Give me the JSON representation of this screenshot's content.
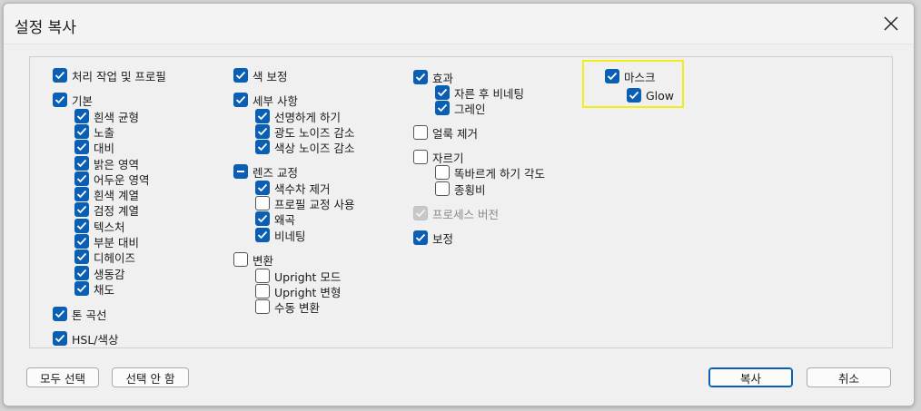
{
  "dialog": {
    "title": "설정 복사",
    "close_icon": "close-icon"
  },
  "col1": {
    "processing": "처리 작업 및 프로필",
    "basic": "기본",
    "basic_items": [
      "흰색 균형",
      "노출",
      "대비",
      "밝은 영역",
      "어두운 영역",
      "흰색 계열",
      "검정 계열",
      "텍스처",
      "부분 대비",
      "디헤이즈",
      "생동감",
      "채도"
    ],
    "tone_curve": "톤 곡선",
    "hsl": "HSL/색상"
  },
  "col2": {
    "color_grading": "색 보정",
    "detail": "세부 사항",
    "detail_items": [
      "선명하게 하기",
      "광도 노이즈 감소",
      "색상 노이즈 감소"
    ],
    "lens": "렌즈 교정",
    "lens_items": [
      "색수차 제거",
      "프로필 교정 사용",
      "왜곡",
      "비네팅"
    ],
    "transform": "변환",
    "transform_items": [
      "Upright 모드",
      "Upright 변형",
      "수동 변환"
    ]
  },
  "col3": {
    "effects": "효과",
    "effects_items": [
      "자른 후 비네팅",
      "그레인"
    ],
    "spot_removal": "얼룩 제거",
    "crop": "자르기",
    "crop_items": [
      "똑바르게 하기 각도",
      "종횡비"
    ],
    "process_version": "프로세스 버전",
    "calibration": "보정"
  },
  "col4": {
    "masks": "마스크",
    "masks_items": [
      "Glow"
    ]
  },
  "buttons": {
    "select_all": "모두 선택",
    "select_none": "선택 안 함",
    "copy": "복사",
    "cancel": "취소"
  },
  "colors": {
    "accent": "#0a5fb4",
    "highlight": "#f2ec18"
  }
}
